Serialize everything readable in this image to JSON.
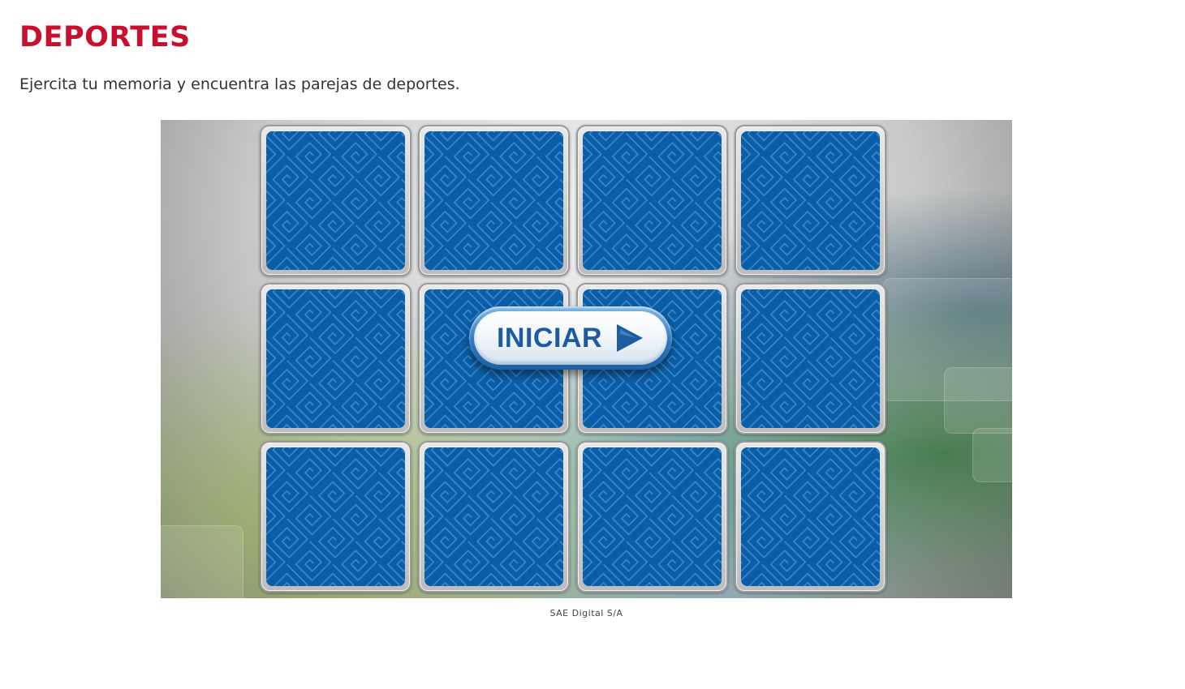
{
  "page": {
    "title": "DEPORTES",
    "description": "Ejercita tu memoria y encuentra las parejas de deportes.",
    "credit": "SAE Digital S/A"
  },
  "game": {
    "start_label": "INICIAR",
    "start_icon": "play-icon",
    "card_back_icon": "greek-key-pattern-icon",
    "colors": {
      "title": "#c8102e",
      "card_back": "#0a5ea8",
      "button_text": "#1d5c9e"
    },
    "grid": {
      "columns": 4,
      "rows": 3
    }
  }
}
